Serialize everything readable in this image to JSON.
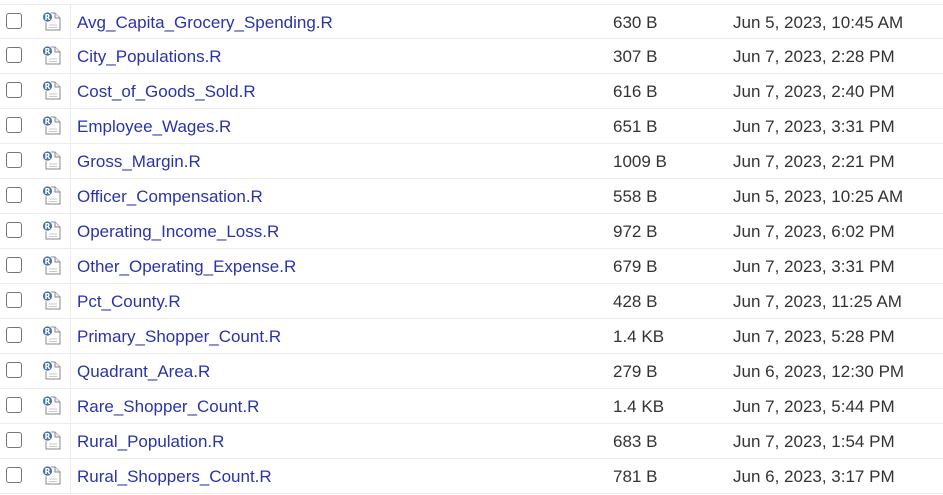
{
  "files": [
    {
      "name": "Avg_Capita_Grocery_Spending.R",
      "size": "630 B",
      "modified": "Jun 5, 2023, 10:45 AM",
      "icon": "r-file-icon"
    },
    {
      "name": "City_Populations.R",
      "size": "307 B",
      "modified": "Jun 7, 2023, 2:28 PM",
      "icon": "r-file-icon"
    },
    {
      "name": "Cost_of_Goods_Sold.R",
      "size": "616 B",
      "modified": "Jun 7, 2023, 2:40 PM",
      "icon": "r-file-icon"
    },
    {
      "name": "Employee_Wages.R",
      "size": "651 B",
      "modified": "Jun 7, 2023, 3:31 PM",
      "icon": "r-file-icon"
    },
    {
      "name": "Gross_Margin.R",
      "size": "1009 B",
      "modified": "Jun 7, 2023, 2:21 PM",
      "icon": "r-file-icon"
    },
    {
      "name": "Officer_Compensation.R",
      "size": "558 B",
      "modified": "Jun 5, 2023, 10:25 AM",
      "icon": "r-file-icon"
    },
    {
      "name": "Operating_Income_Loss.R",
      "size": "972 B",
      "modified": "Jun 7, 2023, 6:02 PM",
      "icon": "r-file-icon"
    },
    {
      "name": "Other_Operating_Expense.R",
      "size": "679 B",
      "modified": "Jun 7, 2023, 3:31 PM",
      "icon": "r-file-icon"
    },
    {
      "name": "Pct_County.R",
      "size": "428 B",
      "modified": "Jun 7, 2023, 11:25 AM",
      "icon": "r-file-icon"
    },
    {
      "name": "Primary_Shopper_Count.R",
      "size": "1.4 KB",
      "modified": "Jun 7, 2023, 5:28 PM",
      "icon": "r-file-icon"
    },
    {
      "name": "Quadrant_Area.R",
      "size": "279 B",
      "modified": "Jun 6, 2023, 12:30 PM",
      "icon": "r-file-icon"
    },
    {
      "name": "Rare_Shopper_Count.R",
      "size": "1.4 KB",
      "modified": "Jun 7, 2023, 5:44 PM",
      "icon": "r-file-icon"
    },
    {
      "name": "Rural_Population.R",
      "size": "683 B",
      "modified": "Jun 7, 2023, 1:54 PM",
      "icon": "r-file-icon"
    },
    {
      "name": "Rural_Shoppers_Count.R",
      "size": "781 B",
      "modified": "Jun 6, 2023, 3:17 PM",
      "icon": "r-file-icon"
    }
  ],
  "colors": {
    "link": "#2a33a8",
    "text": "#333333",
    "r_badge": "#4a6fb0"
  }
}
